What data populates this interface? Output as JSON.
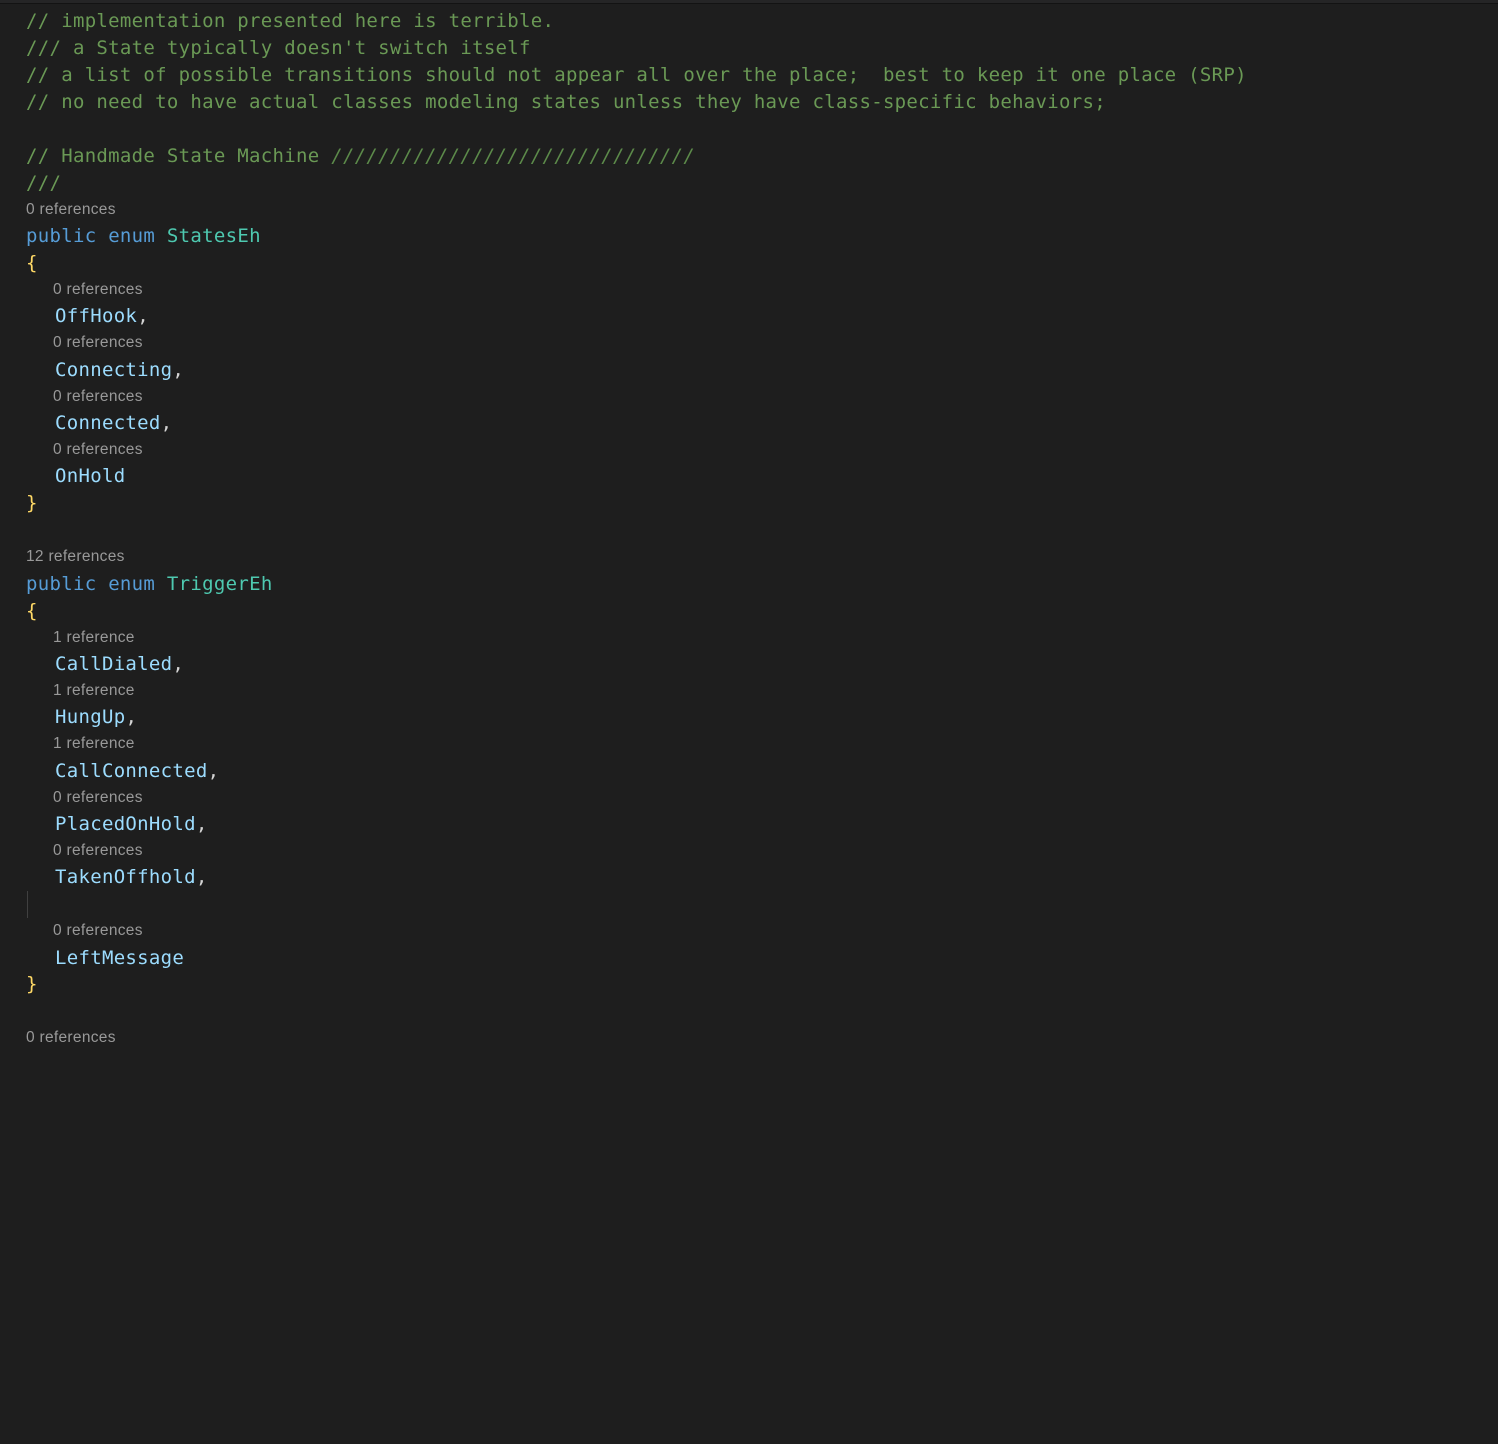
{
  "comments": {
    "c1": "// implementation presented here is terrible.",
    "c2": "/// a State typically doesn't switch itself",
    "c3": "// a list of possible transitions should not appear all over the place;  best to keep it one place (SRP)",
    "c4": "// no need to have actual classes modeling states unless they have class-specific behaviors;",
    "c5": "// Handmade State Machine ",
    "c5deco": "///////////////////////////////",
    "c6": "///"
  },
  "keywords": {
    "public": "public",
    "enum": "enum"
  },
  "braces": {
    "open": "{",
    "close": "}"
  },
  "punct": {
    "comma": ","
  },
  "enum1": {
    "name": "StatesEh",
    "codelens": "0 references",
    "members": [
      {
        "lens": "0 references",
        "name": "OffHook",
        "trail": ","
      },
      {
        "lens": "0 references",
        "name": "Connecting",
        "trail": ","
      },
      {
        "lens": "0 references",
        "name": "Connected",
        "trail": ","
      },
      {
        "lens": "0 references",
        "name": "OnHold",
        "trail": ""
      }
    ]
  },
  "enum2": {
    "name": "TriggerEh",
    "codelens": "12 references",
    "members": [
      {
        "lens": "1 reference",
        "name": "CallDialed",
        "trail": ","
      },
      {
        "lens": "1 reference",
        "name": "HungUp",
        "trail": ","
      },
      {
        "lens": "1 reference",
        "name": "CallConnected",
        "trail": ","
      },
      {
        "lens": "0 references",
        "name": "PlacedOnHold",
        "trail": ","
      },
      {
        "lens": "0 references",
        "name": "TakenOffhold",
        "trail": ","
      },
      {
        "lens": "0 references",
        "name": "LeftMessage",
        "trail": ""
      }
    ]
  },
  "trailing_codelens": "0 references"
}
